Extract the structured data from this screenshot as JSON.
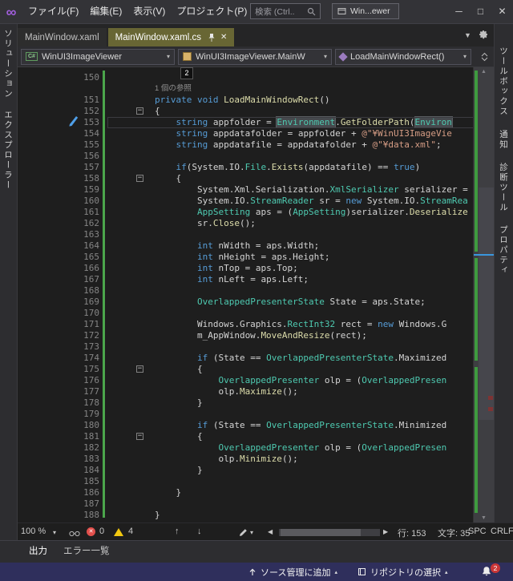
{
  "title_bar": {
    "menus": [
      "ファイル(F)",
      "編集(E)",
      "表示(V)",
      "プロジェクト(P)"
    ],
    "search_placeholder": "検索 (Ctrl..",
    "window_switcher": "Win...ewer"
  },
  "icons": {
    "minimize": "─",
    "maximize": "□",
    "close": "✕",
    "caret_down": "▾",
    "caret_up": "▴",
    "overflow_caret": "▼",
    "arrow_up": "↑",
    "arrow_down": "↓",
    "scroll_left": "◀",
    "scroll_right": "▶",
    "scroll_up": "▲",
    "scroll_down": "▼",
    "fold": "−",
    "error_x": "✕"
  },
  "left_sidebar": {
    "label": "ソリューション エクスプローラー"
  },
  "right_sidebar": {
    "items": [
      "ツールボックス",
      "通知",
      "診断ツール",
      "プロパティ"
    ]
  },
  "tabs": [
    {
      "label": "MainWindow.xaml",
      "active": false
    },
    {
      "label": "MainWindow.xaml.cs",
      "active": true
    }
  ],
  "navbar": {
    "project": "WinUI3ImageViewer",
    "type": "WinUI3ImageViewer.MainW",
    "member": "LoadMainWindowRect()"
  },
  "editor": {
    "codelens_badge": "2",
    "lines": [
      {
        "n": 150,
        "s": []
      },
      {
        "lens": true,
        "text": "1 個の参照"
      },
      {
        "n": 151,
        "s": [
          [
            "p",
            "        "
          ],
          [
            "k",
            "private"
          ],
          [
            "p",
            " "
          ],
          [
            "k",
            "void"
          ],
          [
            "p",
            " "
          ],
          [
            "m",
            "LoadMainWindowRect"
          ],
          [
            "p",
            "()"
          ]
        ]
      },
      {
        "n": 152,
        "fold": true,
        "s": [
          [
            "p",
            "        {"
          ]
        ]
      },
      {
        "n": 153,
        "cur": true,
        "s": [
          [
            "p",
            "            "
          ],
          [
            "k",
            "string"
          ],
          [
            "p",
            " appfolder = "
          ],
          [
            "th",
            "Environment"
          ],
          [
            "p",
            "."
          ],
          [
            "m",
            "GetFolderPath"
          ],
          [
            "p",
            "("
          ],
          [
            "th",
            "Environ"
          ]
        ]
      },
      {
        "n": 154,
        "s": [
          [
            "p",
            "            "
          ],
          [
            "k",
            "string"
          ],
          [
            "p",
            " appdatafolder = appfolder + "
          ],
          [
            "s",
            "@\"¥WinUI3ImageVie"
          ]
        ]
      },
      {
        "n": 155,
        "s": [
          [
            "p",
            "            "
          ],
          [
            "k",
            "string"
          ],
          [
            "p",
            " appdatafile = appdatafolder + "
          ],
          [
            "s",
            "@\"¥data.xml\""
          ],
          [
            "p",
            ";"
          ]
        ]
      },
      {
        "n": 156,
        "s": []
      },
      {
        "n": 157,
        "s": [
          [
            "p",
            "            "
          ],
          [
            "k",
            "if"
          ],
          [
            "p",
            "(System.IO."
          ],
          [
            "t",
            "File"
          ],
          [
            "p",
            "."
          ],
          [
            "m",
            "Exists"
          ],
          [
            "p",
            "(appdatafile) == "
          ],
          [
            "k",
            "true"
          ],
          [
            "p",
            ")"
          ]
        ]
      },
      {
        "n": 158,
        "fold": true,
        "s": [
          [
            "p",
            "            {"
          ]
        ]
      },
      {
        "n": 159,
        "s": [
          [
            "p",
            "                System.Xml.Serialization."
          ],
          [
            "t",
            "XmlSerializer"
          ],
          [
            "p",
            " serializer ="
          ]
        ]
      },
      {
        "n": 160,
        "s": [
          [
            "p",
            "                System.IO."
          ],
          [
            "t",
            "StreamReader"
          ],
          [
            "p",
            " sr = "
          ],
          [
            "k",
            "new"
          ],
          [
            "p",
            " System.IO."
          ],
          [
            "t",
            "StreamRea"
          ]
        ]
      },
      {
        "n": 161,
        "s": [
          [
            "p",
            "                "
          ],
          [
            "t",
            "AppSetting"
          ],
          [
            "p",
            " aps = ("
          ],
          [
            "t",
            "AppSetting"
          ],
          [
            "p",
            ")serializer."
          ],
          [
            "m",
            "Deserialize"
          ]
        ]
      },
      {
        "n": 162,
        "s": [
          [
            "p",
            "                sr."
          ],
          [
            "m",
            "Close"
          ],
          [
            "p",
            "();"
          ]
        ]
      },
      {
        "n": 163,
        "s": []
      },
      {
        "n": 164,
        "s": [
          [
            "p",
            "                "
          ],
          [
            "k",
            "int"
          ],
          [
            "p",
            " nWidth = aps.Width;"
          ]
        ]
      },
      {
        "n": 165,
        "s": [
          [
            "p",
            "                "
          ],
          [
            "k",
            "int"
          ],
          [
            "p",
            " nHeight = aps.Height;"
          ]
        ]
      },
      {
        "n": 166,
        "s": [
          [
            "p",
            "                "
          ],
          [
            "k",
            "int"
          ],
          [
            "p",
            " nTop = aps.Top;"
          ]
        ]
      },
      {
        "n": 167,
        "s": [
          [
            "p",
            "                "
          ],
          [
            "k",
            "int"
          ],
          [
            "p",
            " nLeft = aps.Left;"
          ]
        ]
      },
      {
        "n": 168,
        "s": []
      },
      {
        "n": 169,
        "s": [
          [
            "p",
            "                "
          ],
          [
            "t",
            "OverlappedPresenterState"
          ],
          [
            "p",
            " State = aps.State;"
          ]
        ]
      },
      {
        "n": 170,
        "s": []
      },
      {
        "n": 171,
        "s": [
          [
            "p",
            "                Windows.Graphics."
          ],
          [
            "t",
            "RectInt32"
          ],
          [
            "p",
            " rect = "
          ],
          [
            "k",
            "new"
          ],
          [
            "p",
            " Windows.G"
          ]
        ]
      },
      {
        "n": 172,
        "s": [
          [
            "p",
            "                m_AppWindow."
          ],
          [
            "m",
            "MoveAndResize"
          ],
          [
            "p",
            "(rect);"
          ]
        ]
      },
      {
        "n": 173,
        "s": []
      },
      {
        "n": 174,
        "s": [
          [
            "p",
            "                "
          ],
          [
            "k",
            "if"
          ],
          [
            "p",
            " (State == "
          ],
          [
            "t",
            "OverlappedPresenterState"
          ],
          [
            "p",
            ".Maximized"
          ]
        ]
      },
      {
        "n": 175,
        "fold": true,
        "s": [
          [
            "p",
            "                {"
          ]
        ]
      },
      {
        "n": 176,
        "s": [
          [
            "p",
            "                    "
          ],
          [
            "t",
            "OverlappedPresenter"
          ],
          [
            "p",
            " olp = ("
          ],
          [
            "t",
            "OverlappedPresen"
          ]
        ]
      },
      {
        "n": 177,
        "s": [
          [
            "p",
            "                    olp."
          ],
          [
            "m",
            "Maximize"
          ],
          [
            "p",
            "();"
          ]
        ]
      },
      {
        "n": 178,
        "s": [
          [
            "p",
            "                }"
          ]
        ]
      },
      {
        "n": 179,
        "s": []
      },
      {
        "n": 180,
        "s": [
          [
            "p",
            "                "
          ],
          [
            "k",
            "if"
          ],
          [
            "p",
            " (State == "
          ],
          [
            "t",
            "OverlappedPresenterState"
          ],
          [
            "p",
            ".Minimized"
          ]
        ]
      },
      {
        "n": 181,
        "fold": true,
        "s": [
          [
            "p",
            "                {"
          ]
        ]
      },
      {
        "n": 182,
        "s": [
          [
            "p",
            "                    "
          ],
          [
            "t",
            "OverlappedPresenter"
          ],
          [
            "p",
            " olp = ("
          ],
          [
            "t",
            "OverlappedPresen"
          ]
        ]
      },
      {
        "n": 183,
        "s": [
          [
            "p",
            "                    olp."
          ],
          [
            "m",
            "Minimize"
          ],
          [
            "p",
            "();"
          ]
        ]
      },
      {
        "n": 184,
        "s": [
          [
            "p",
            "                }"
          ]
        ]
      },
      {
        "n": 185,
        "s": []
      },
      {
        "n": 186,
        "s": [
          [
            "p",
            "            }"
          ]
        ]
      },
      {
        "n": 187,
        "s": []
      },
      {
        "n": 188,
        "s": [
          [
            "p",
            "        }"
          ]
        ]
      }
    ]
  },
  "editor_status": {
    "zoom": "100 %",
    "errors": "0",
    "warnings": "4",
    "line": "行: 153",
    "column": "文字: 35",
    "encoding": "SPC",
    "line_ending": "CRLF"
  },
  "bottom_panel": {
    "tabs": [
      "出力",
      "エラー一覧"
    ]
  },
  "status_bar": {
    "add_source_control": "ソース管理に追加",
    "select_repo": "リポジトリの選択",
    "badge": "2"
  },
  "colors": {
    "active_tab": "#686634",
    "status_bar": "#2f2f5c",
    "keyword": "#569cd6",
    "type": "#4ec9b0",
    "method": "#dcdcaa",
    "string": "#d69d85",
    "change_tracking": "#4ba64b",
    "error": "#e2504c",
    "warning": "#f2c810"
  }
}
